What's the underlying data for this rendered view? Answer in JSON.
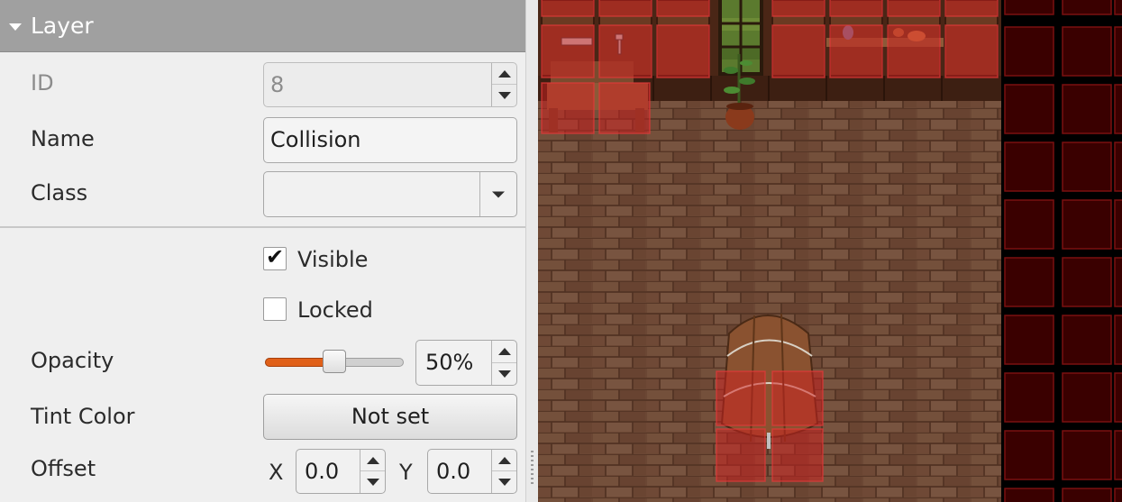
{
  "panel": {
    "section_title": "Layer",
    "id_label": "ID",
    "id_value": "8",
    "name_label": "Name",
    "name_value": "Collision",
    "class_label": "Class",
    "class_value": "",
    "visible_label": "Visible",
    "visible_checked": true,
    "locked_label": "Locked",
    "locked_checked": false,
    "opacity_label": "Opacity",
    "opacity_value": "50%",
    "opacity_fraction": 0.5,
    "tint_label": "Tint Color",
    "tint_button": "Not set",
    "offset_label": "Offset",
    "offset_x_label": "X",
    "offset_x_value": "0.0",
    "offset_y_label": "Y",
    "offset_y_value": "0.0",
    "check_glyph": "✔"
  },
  "colors": {
    "header_bg": "#a0a0a0",
    "slider_fill": "#e06019",
    "collision_overlay": "#d42020",
    "wood_floor": "#6e4a35",
    "wall_panel": "#5a2a17"
  }
}
